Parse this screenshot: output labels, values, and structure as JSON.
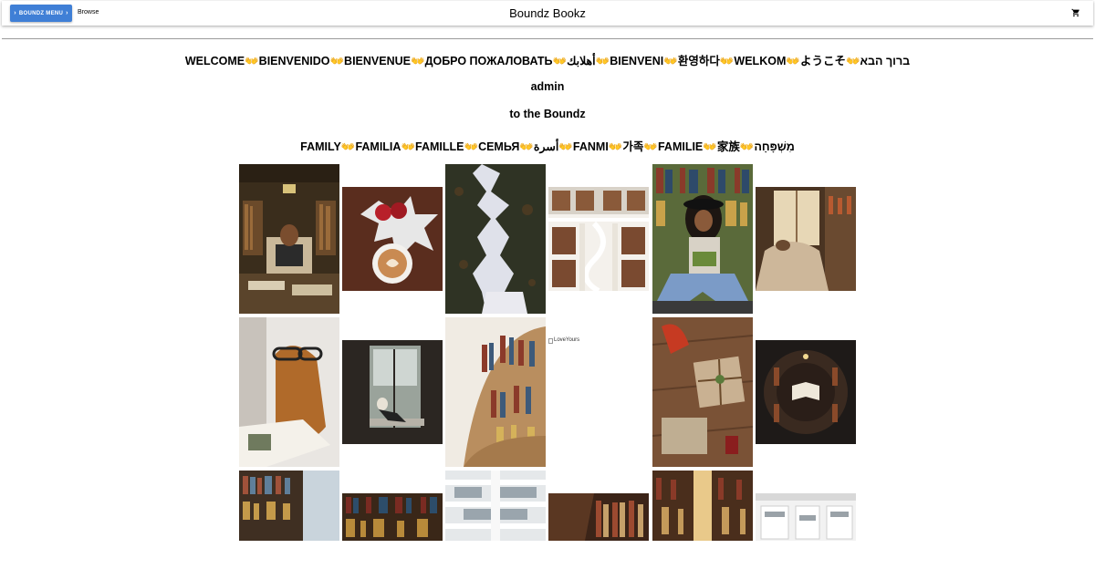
{
  "header": {
    "menu_label": "BOUNDZ MENU",
    "browse_label": "Browse",
    "brand": "Boundz Bookz"
  },
  "welcome": {
    "words": [
      "WELCOME",
      "BIENVENIDO",
      "BIENVENUE",
      "ДОБРО ПОЖАЛОВАТЬ",
      "أهلابك",
      "BIENVENI",
      "환영하다",
      "WELKOM",
      "ようこそ",
      "ברוך הבא"
    ],
    "separator": "👐"
  },
  "username": "admin",
  "tagline": "to the Boundz",
  "family": {
    "words": [
      "FAMILY",
      "FAMILIA",
      "FAMILLE",
      "СЕМЬЯ",
      "أسرة",
      "FANMI",
      "가족",
      "FAMILIE",
      "家族",
      "מִשְׁפָּחָה"
    ],
    "separator": "👐"
  },
  "gallery": {
    "broken_image_alt": "LoveYours"
  }
}
